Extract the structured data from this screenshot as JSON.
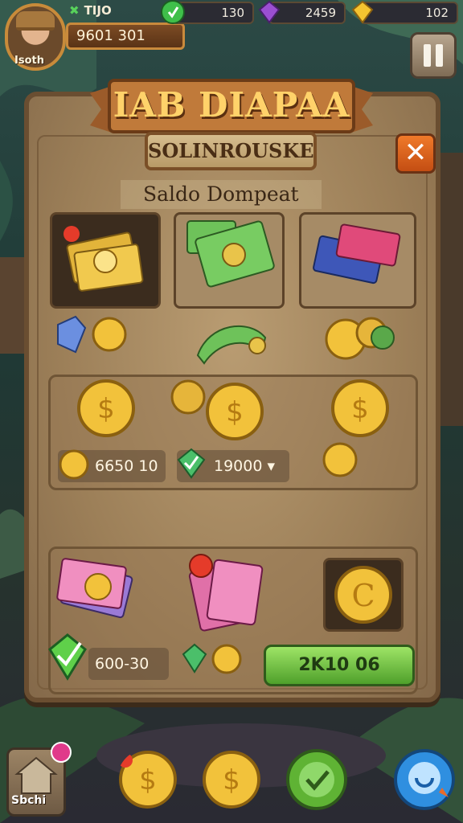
{
  "header": {
    "level_label": "TIJO",
    "player_label": "Isoth",
    "name_plate": "9601 301"
  },
  "resources": [
    {
      "name": "gems-green",
      "value": "130",
      "color": "#3fbf4a"
    },
    {
      "name": "gems-purple",
      "value": "2459",
      "color": "#9b4fd1"
    },
    {
      "name": "gold",
      "value": "102",
      "color": "#f4c430"
    }
  ],
  "panel": {
    "title": "IAB DIAPAA",
    "subtitle": "SOLINROUSKE",
    "section_title": "Saldo Dompeat",
    "close_symbol": "✕"
  },
  "stats": {
    "coins_value": "6650 10",
    "gems_value": "19000 ",
    "gems_arrow": "▾",
    "bottom_value": "600-30",
    "action_label": "2K10 06"
  },
  "bottom_bar": {
    "shop_label": "Sbchi"
  },
  "colors": {
    "panel": "#a68b66",
    "accent_orange": "#e6692a",
    "accent_green": "#5fb334",
    "gold": "#f2c23b"
  }
}
